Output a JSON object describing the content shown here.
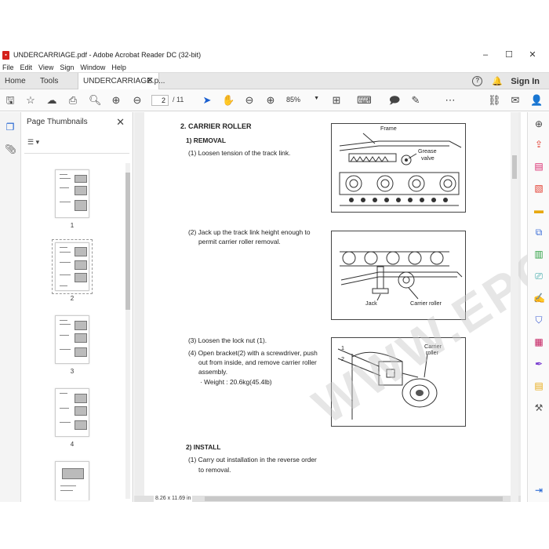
{
  "window": {
    "title": "UNDERCARRIAGE.pdf - Adobe Acrobat Reader DC (32-bit)",
    "pdf_icon": "pdf-file-icon"
  },
  "menu": [
    "File",
    "Edit",
    "View",
    "Sign",
    "Window",
    "Help"
  ],
  "tabs": {
    "home": "Home",
    "tools": "Tools",
    "doc": "UNDERCARRIAGE.p..."
  },
  "account": {
    "sign_in": "Sign In"
  },
  "toolbar": {
    "page_current": "2",
    "page_total": "/ 11",
    "zoom": "85%"
  },
  "thumbnails": {
    "title": "Page Thumbnails",
    "pages": [
      "1",
      "2",
      "3",
      "4"
    ]
  },
  "document": {
    "section": "2.  CARRIER ROLLER",
    "removal": "1)  REMOVAL",
    "step1": "(1) Loosen tension of the track link.",
    "step2a": "(2) Jack up the track link height enough to",
    "step2b": "permit carrier roller removal.",
    "step3": "(3) Loosen the lock nut (1).",
    "step4a": "(4) Open bracket(2) with a screwdriver, push",
    "step4b": "out from inside, and remove carrier roller",
    "step4c": "assembly.",
    "step4d": "· Weight : 20.6kg(45.4lb)",
    "install": "2)  INSTALL",
    "inst1a": "(1) Carry out installation in the reverse order",
    "inst1b": "to removal.",
    "fig1": {
      "frame": "Frame",
      "grease1": "Grease",
      "grease2": "valve"
    },
    "fig2": {
      "jack": "Jack",
      "roller": "Carrier roller"
    },
    "fig3": {
      "n1": "1",
      "n2": "2",
      "roller1": "Carrier",
      "roller2": "roller"
    },
    "watermark": "WWW.EPCDEPO.COM",
    "page_size": "8.26 x 11.69 in"
  }
}
